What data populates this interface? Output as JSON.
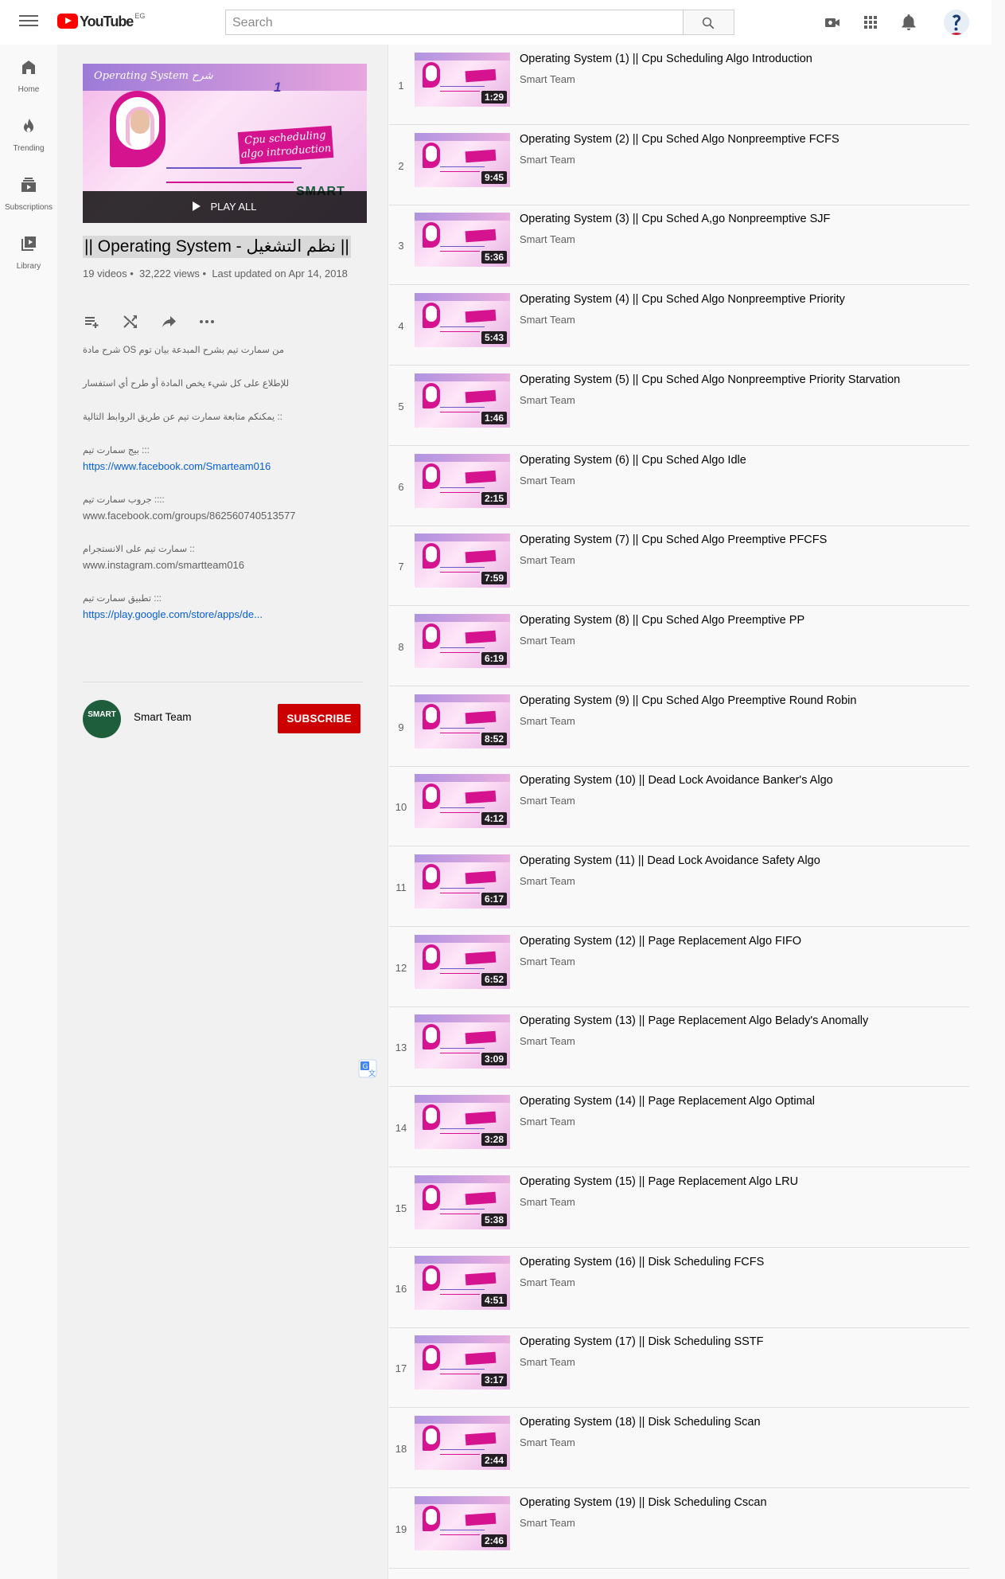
{
  "header": {
    "logo_text": "YouTube",
    "country_code": "EG",
    "search_placeholder": "Search"
  },
  "sidenav": [
    {
      "label": "Home",
      "icon": "home-icon"
    },
    {
      "label": "Trending",
      "icon": "fire-icon"
    },
    {
      "label": "Subscriptions",
      "icon": "subscriptions-icon"
    },
    {
      "label": "Library",
      "icon": "library-icon"
    }
  ],
  "playlist": {
    "thumbnail": {
      "banner_text": "Operating System شرح",
      "number": "1",
      "tag_text": "Cpu scheduling algo introduction",
      "brand": "SMART"
    },
    "play_all": "PLAY ALL",
    "title": "|| Operating System - نظم التشغيل ||",
    "videos_count": "19 videos",
    "views": "32,222 views",
    "last_updated": "Last updated on Apr 14, 2018",
    "description": {
      "line1": "شرح مادة OS من سمارت تيم بشرح المبدعة بيان توم",
      "line2": "للإطلاع على كل شيء يخص المادة أو طرح أي استفسار",
      "line3": "يمكنكم متابعة سمارت تيم عن طريق الروابط التالية ::",
      "page_label": "بيج سمارت تيم :::",
      "page_link": "https://www.facebook.com/Smarteam016",
      "group_label": "جروب سمارت تيم ::::",
      "group_link": "www.facebook.com/groups/862560740513577",
      "insta_label": "سمارت تيم على الانستجرام ::",
      "insta_link": "www.instagram.com/smartteam016",
      "app_label": "تطبيق سمارت تيم :::",
      "app_link": "https://play.google.com/store/apps/de..."
    },
    "channel_name": "Smart Team",
    "channel_avatar_text": "SMART",
    "subscribe_label": "SUBSCRIBE"
  },
  "videos": [
    {
      "index": "1",
      "title": "Operating System (1) || Cpu Scheduling Algo Introduction",
      "channel": "Smart Team",
      "duration": "1:29"
    },
    {
      "index": "2",
      "title": "Operating System (2) || Cpu Sched Algo Nonpreemptive FCFS",
      "channel": "Smart Team",
      "duration": "9:45"
    },
    {
      "index": "3",
      "title": "Operating System (3) || Cpu Sched A,go Nonpreemptive SJF",
      "channel": "Smart Team",
      "duration": "5:36"
    },
    {
      "index": "4",
      "title": "Operating System (4) || Cpu Sched Algo Nonpreemptive Priority",
      "channel": "Smart Team",
      "duration": "5:43"
    },
    {
      "index": "5",
      "title": "Operating System (5) || Cpu Sched Algo Nonpreemptive Priority Starvation",
      "channel": "Smart Team",
      "duration": "1:46"
    },
    {
      "index": "6",
      "title": "Operating System (6) || Cpu Sched Algo Idle",
      "channel": "Smart Team",
      "duration": "2:15"
    },
    {
      "index": "7",
      "title": "Operating System (7) || Cpu Sched Algo Preemptive PFCFS",
      "channel": "Smart Team",
      "duration": "7:59"
    },
    {
      "index": "8",
      "title": "Operating System (8) || Cpu Sched Algo Preemptive PP",
      "channel": "Smart Team",
      "duration": "6:19"
    },
    {
      "index": "9",
      "title": "Operating System (9) || Cpu Sched Algo Preemptive Round Robin",
      "channel": "Smart Team",
      "duration": "8:52"
    },
    {
      "index": "10",
      "title": "Operating System (10) || Dead Lock Avoidance Banker's Algo",
      "channel": "Smart Team",
      "duration": "4:12"
    },
    {
      "index": "11",
      "title": "Operating System (11) || Dead Lock Avoidance Safety Algo",
      "channel": "Smart Team",
      "duration": "6:17"
    },
    {
      "index": "12",
      "title": "Operating System (12) || Page Replacement Algo FIFO",
      "channel": "Smart Team",
      "duration": "6:52"
    },
    {
      "index": "13",
      "title": "Operating System (13) || Page Replacement Algo Belady's Anomally",
      "channel": "Smart Team",
      "duration": "3:09"
    },
    {
      "index": "14",
      "title": "Operating System (14) || Page Replacement Algo Optimal",
      "channel": "Smart Team",
      "duration": "3:28"
    },
    {
      "index": "15",
      "title": "Operating System (15) || Page Replacement Algo LRU",
      "channel": "Smart Team",
      "duration": "5:38"
    },
    {
      "index": "16",
      "title": "Operating System (16) || Disk Scheduling FCFS",
      "channel": "Smart Team",
      "duration": "4:51"
    },
    {
      "index": "17",
      "title": "Operating System (17) || Disk Scheduling SSTF",
      "channel": "Smart Team",
      "duration": "3:17"
    },
    {
      "index": "18",
      "title": "Operating System (18) || Disk Scheduling Scan",
      "channel": "Smart Team",
      "duration": "2:44"
    },
    {
      "index": "19",
      "title": "Operating System (19) || Disk Scheduling Cscan",
      "channel": "Smart Team",
      "duration": "2:46"
    }
  ],
  "colors": {
    "brand_red": "#ff0000",
    "subscribe_red": "#cc0000",
    "link_blue": "#065fd4",
    "thumb_magenta": "#d5138f"
  }
}
